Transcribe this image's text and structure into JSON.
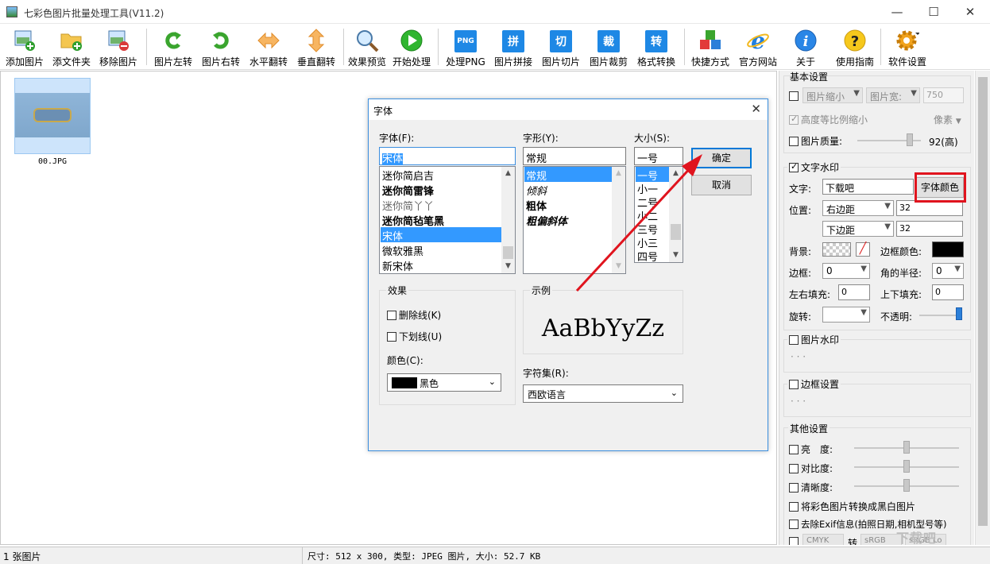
{
  "window": {
    "title": "七彩色图片批量处理工具(V11.2)",
    "min": "—",
    "max": "☐",
    "close": "✕"
  },
  "toolbar": [
    {
      "label": "添加图片",
      "icon": "add-image-icon"
    },
    {
      "label": "添文件夹",
      "icon": "add-folder-icon"
    },
    {
      "label": "移除图片",
      "icon": "remove-image-icon"
    },
    {
      "label": "图片左转",
      "icon": "rotate-left-icon"
    },
    {
      "label": "图片右转",
      "icon": "rotate-right-icon"
    },
    {
      "label": "水平翻转",
      "icon": "flip-horizontal-icon"
    },
    {
      "label": "垂直翻转",
      "icon": "flip-vertical-icon"
    },
    {
      "label": "效果预览",
      "icon": "magnifier-icon"
    },
    {
      "label": "开始处理",
      "icon": "play-icon"
    },
    {
      "label": "处理PNG",
      "icon": "png-icon",
      "glyph": "PNG"
    },
    {
      "label": "图片拼接",
      "icon": "splice-icon",
      "glyph": "拼"
    },
    {
      "label": "图片切片",
      "icon": "slice-icon",
      "glyph": "切"
    },
    {
      "label": "图片裁剪",
      "icon": "crop-icon",
      "glyph": "裁"
    },
    {
      "label": "格式转换",
      "icon": "convert-icon",
      "glyph": "转"
    },
    {
      "label": "快捷方式",
      "icon": "shortcut-icon"
    },
    {
      "label": "官方网站",
      "icon": "ie-icon"
    },
    {
      "label": "关于",
      "icon": "info-icon"
    },
    {
      "label": "使用指南",
      "icon": "help-icon"
    },
    {
      "label": "软件设置",
      "icon": "gear-icon"
    }
  ],
  "canvas": {
    "thumb_name": "00.JPG"
  },
  "panel": {
    "basic": {
      "title": "基本设置",
      "shrink": "图片缩小",
      "width": "图片宽:",
      "width_val": "750",
      "keep_ratio": "高度等比例缩小",
      "unit": "像素",
      "quality": "图片质量:",
      "quality_val": "92(高)",
      "quality_level": 0.92
    },
    "text_wm": {
      "title": "文字水印",
      "text_label": "文字:",
      "text_val": "下载吧",
      "font_color_btn": "字体颜色",
      "pos_label": "位置:",
      "pos_x": "右边距",
      "pos_x_val": "32",
      "pos_y": "下边距",
      "pos_y_val": "32",
      "bg_label": "背景:",
      "border_color_label": "边框颜色:",
      "border_label": "边框:",
      "border_val": "0",
      "radius_label": "角的半径:",
      "radius_val": "0",
      "lr_pad_label": "左右填充:",
      "lr_pad_val": "0",
      "tb_pad_label": "上下填充:",
      "tb_pad_val": "0",
      "rotate_label": "旋转:",
      "opacity_label": "不透明:"
    },
    "image_wm": {
      "title": "图片水印",
      "dots": "· · ·"
    },
    "border": {
      "title": "边框设置",
      "dots": "· · ·"
    },
    "other": {
      "title": "其他设置",
      "brightness": "亮　度:",
      "contrast": "对比度:",
      "sharpness": "清晰度:",
      "bw": "将彩色图片转换成黑白图片",
      "exif": "去除Exif信息(拍照日期,相机型号等)",
      "cmyk": "CMYK",
      "to": "转",
      "srgb1": "sRGB",
      "srgb2": "sRGB Lo"
    }
  },
  "status": {
    "left": "1 张图片",
    "right": "尺寸: 512 x 300, 类型: JPEG 图片, 大小: 52.7 KB"
  },
  "dialog": {
    "title": "字体",
    "close": "✕",
    "font_label": "字体(F):",
    "font_val": "宋体",
    "fonts": [
      "迷你简启吉",
      "迷你简雷锋",
      "迷你简丫丫",
      "迷你简毡笔黑",
      "宋体",
      "微软雅黑",
      "新宋体"
    ],
    "style_label": "字形(Y):",
    "style_val": "常规",
    "styles": [
      "常规",
      "倾斜",
      "粗体",
      "粗偏斜体"
    ],
    "size_label": "大小(S):",
    "size_val": "一号",
    "sizes": [
      "一号",
      "小一",
      "二号",
      "小二",
      "三号",
      "小三",
      "四号"
    ],
    "ok": "确定",
    "cancel": "取消",
    "effects": "效果",
    "strike": "删除线(K)",
    "underline": "下划线(U)",
    "color_label": "颜色(C):",
    "color_val": "黑色",
    "sample_label": "示例",
    "sample": "AaBbYyZz",
    "charset_label": "字符集(R):",
    "charset_val": "西欧语言"
  },
  "watermark": "下载吧",
  "colors": {
    "accent": "#3399ff",
    "highlight": "#e0141e",
    "arrow": "#e0141e"
  }
}
